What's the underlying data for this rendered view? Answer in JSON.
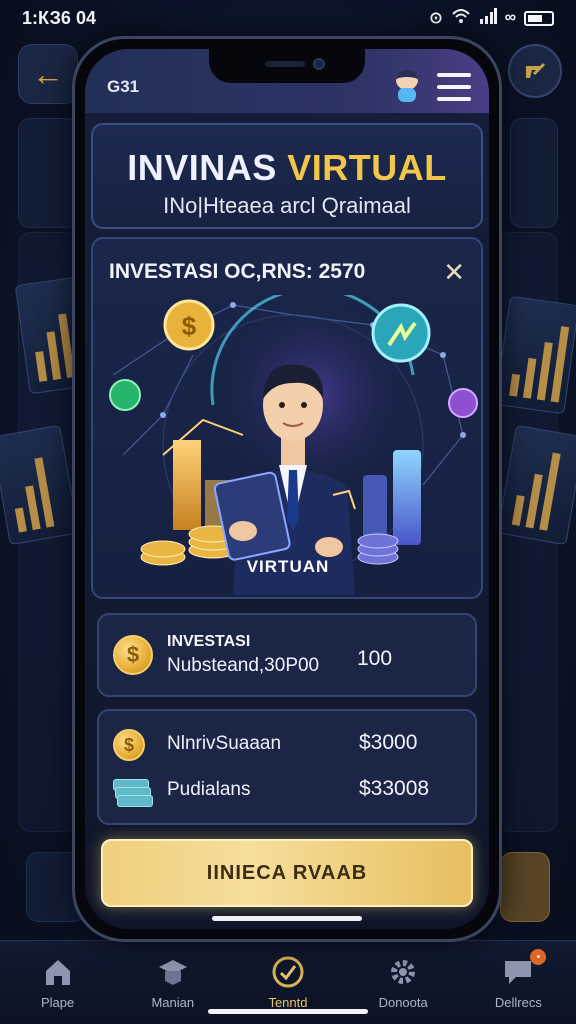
{
  "status_bar": {
    "time": "1:КЗ6 04",
    "icons": [
      "alarm-icon",
      "wifi-icon",
      "signal-icon",
      "link-icon",
      "battery-icon"
    ]
  },
  "background": {
    "back_icon": "arrow-left-icon",
    "logo_icon": "brand-logo-icon"
  },
  "app_header": {
    "time": "G31",
    "menu_icon": "hamburger-menu-icon"
  },
  "title_card": {
    "title_part1": "INVINAS",
    "title_part2": "VIRTUAL",
    "subtitle": "INo|Hteaea arcl Qraimaal"
  },
  "hero": {
    "title": "INVESTASI ОС,RNS: 2570",
    "close_symbol": "✕",
    "image_label": "VIRTUAN"
  },
  "summary": {
    "title": "INVESTASI",
    "label": "Nubsteand,30P00",
    "value": "100"
  },
  "details": {
    "rows": [
      {
        "icon": "coin-icon",
        "label": "NlnrivSuaaan",
        "value": "$3000"
      },
      {
        "icon": "cash-stack-icon",
        "label": "Pudialans",
        "value": "$33008"
      }
    ]
  },
  "cta": {
    "label": "IINIЕСA RVAAB"
  },
  "bottom_nav": {
    "items": [
      {
        "label": "Plape",
        "icon": "home-icon",
        "active": false
      },
      {
        "label": "Manian",
        "icon": "graduation-cap-icon",
        "active": false
      },
      {
        "label": "Tenntd",
        "icon": "coin-check-icon",
        "active": true
      },
      {
        "label": "Donoota",
        "icon": "gear-icon",
        "active": false
      },
      {
        "label": "Dellrecs",
        "icon": "chat-icon",
        "active": false
      }
    ]
  },
  "colors": {
    "accent_gold": "#f2c64a",
    "background": "#0b1222",
    "card": "#1b2546"
  }
}
